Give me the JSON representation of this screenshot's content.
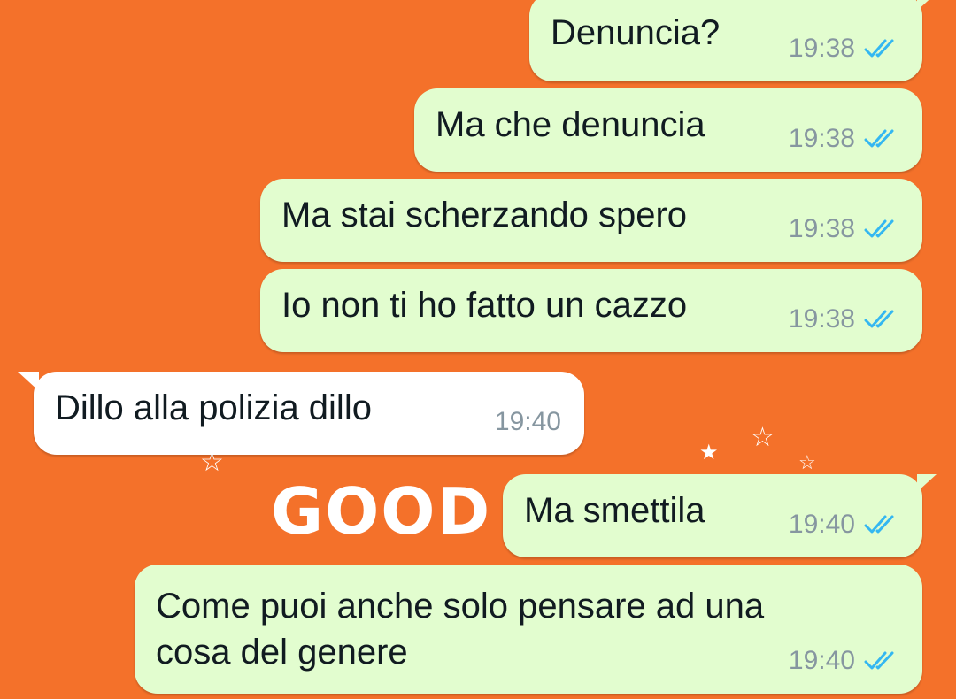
{
  "chat": {
    "wallpaper_text": "GOOD",
    "messages": [
      {
        "text": "Denuncia?",
        "time": "19:38",
        "direction": "outgoing",
        "status": "read"
      },
      {
        "text": "Ma che denuncia",
        "time": "19:38",
        "direction": "outgoing",
        "status": "read"
      },
      {
        "text": "Ma stai scherzando spero",
        "time": "19:38",
        "direction": "outgoing",
        "status": "read"
      },
      {
        "text": "Io non ti ho fatto un cazzo",
        "time": "19:38",
        "direction": "outgoing",
        "status": "read"
      },
      {
        "text": "Dillo alla polizia dillo",
        "time": "19:40",
        "direction": "incoming"
      },
      {
        "text": "Ma smettila",
        "time": "19:40",
        "direction": "outgoing",
        "status": "read"
      },
      {
        "text_line1": "Come puoi anche solo pensare ad una",
        "text_line2": "cosa del genere",
        "time": "19:40",
        "direction": "outgoing",
        "status": "read"
      }
    ]
  },
  "colors": {
    "background": "#f4712a",
    "outgoing_bubble": "#e2fdcf",
    "incoming_bubble": "#ffffff",
    "read_tick": "#34b7f1"
  },
  "icons": {
    "read_receipt": "double-check-icon"
  }
}
